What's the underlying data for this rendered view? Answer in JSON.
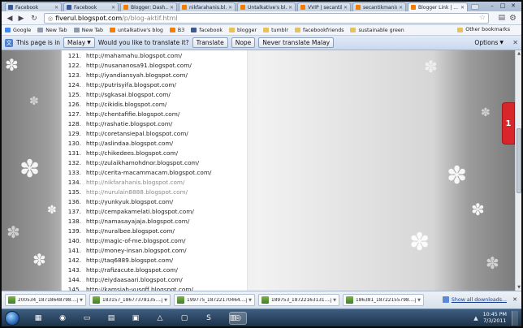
{
  "tabs": [
    {
      "label": "Facebook",
      "color": "#3b5998"
    },
    {
      "label": "Facebook",
      "color": "#3b5998"
    },
    {
      "label": "Blogger: Dash...",
      "color": "#f57d00"
    },
    {
      "label": "nikfarahanis.bl...",
      "color": "#f57d00"
    },
    {
      "label": "Untalkative's bl...",
      "color": "#f57d00"
    },
    {
      "label": "VVIP | secantik...",
      "color": "#f57d00"
    },
    {
      "label": "secantikmanis",
      "color": "#f57d00"
    },
    {
      "label": "Blogger Link | ...",
      "color": "#f57d00"
    }
  ],
  "toolbar": {
    "url_host": "fiverul.blogspot.com",
    "url_path": "/p/blog-aktif.html"
  },
  "bookmarks": [
    {
      "label": "Google",
      "color": "#4285f4"
    },
    {
      "label": "New Tab",
      "color": "#8c9aab"
    },
    {
      "label": "New Tab",
      "color": "#8c9aab"
    },
    {
      "label": "untalkative's blog",
      "color": "#f57d00"
    },
    {
      "label": "B3",
      "color": "#f57d00"
    },
    {
      "label": "facebook",
      "color": "#3b5998"
    },
    {
      "label": "blogger",
      "color": "#e8c15a"
    },
    {
      "label": "tumblr",
      "color": "#e8c15a"
    },
    {
      "label": "facebookfriends",
      "color": "#e8c15a"
    },
    {
      "label": "sustainable green",
      "color": "#e8c15a"
    }
  ],
  "other_bookmarks": "Other bookmarks",
  "translate": {
    "prefix": "This page is in",
    "language": "Malay",
    "question": "Would you like to translate it?",
    "translate_btn": "Translate",
    "nope_btn": "Nope",
    "never_btn": "Never translate Malay",
    "options": "Options"
  },
  "links": [
    {
      "num": "121.",
      "url": "http://mahamahu.blogspot.com/",
      "visited": false
    },
    {
      "num": "122.",
      "url": "http://nusananosa91.blogspot.com/",
      "visited": false
    },
    {
      "num": "123.",
      "url": "http://iyandiansyah.blogspot.com/",
      "visited": false
    },
    {
      "num": "124.",
      "url": "http://putrisyifa.blogspot.com/",
      "visited": false
    },
    {
      "num": "125.",
      "url": "http://sgkasai.blogspot.com/",
      "visited": false
    },
    {
      "num": "126.",
      "url": "http://cikidis.blogspot.com/",
      "visited": false
    },
    {
      "num": "127.",
      "url": "http://chentafifie.blogspot.com/",
      "visited": false
    },
    {
      "num": "128.",
      "url": "http://rashatie.blogspot.com/",
      "visited": false
    },
    {
      "num": "129.",
      "url": "http://coretansiepal.blogspot.com/",
      "visited": false
    },
    {
      "num": "130.",
      "url": "http://aslindaa.blogspot.com/",
      "visited": false
    },
    {
      "num": "131.",
      "url": "http://chikedees.blogspot.com/",
      "visited": false
    },
    {
      "num": "132.",
      "url": "http://zulaikhamohdnor.blogspot.com/",
      "visited": false
    },
    {
      "num": "133.",
      "url": "http://cerita-macammacam.blogspot.com/",
      "visited": false
    },
    {
      "num": "134.",
      "url": "http://nikfarahanis.blogspot.com/",
      "visited": true
    },
    {
      "num": "135.",
      "url": "http://nurulain8888.blogspot.com/",
      "visited": true
    },
    {
      "num": "136.",
      "url": "http://yunkyuk.blogspot.com/",
      "visited": false
    },
    {
      "num": "137.",
      "url": "http://cempakamelati.blogspot.com/",
      "visited": false
    },
    {
      "num": "138.",
      "url": "http://namasayajaja.blogspot.com/",
      "visited": false
    },
    {
      "num": "139.",
      "url": "http://nuralbee.blogspot.com/",
      "visited": false
    },
    {
      "num": "140.",
      "url": "http://magic-of-me.blogspot.com/",
      "visited": false
    },
    {
      "num": "141.",
      "url": "http://money-insan.blogspot.com/",
      "visited": false
    },
    {
      "num": "142.",
      "url": "http://taq6889.blogspot.com/",
      "visited": false
    },
    {
      "num": "143.",
      "url": "http://rafizacute.blogspot.com/",
      "visited": false
    },
    {
      "num": "144.",
      "url": "http://eiydaasaari.blogspot.com/",
      "visited": false
    },
    {
      "num": "145.",
      "url": "http://kamsiah-yusoff.blogspot.com/",
      "visited": false
    }
  ],
  "downloads": [
    {
      "name": "200534_18718648798....jpg"
    },
    {
      "name": "183157_18677378135....jpg"
    },
    {
      "name": "199775_18722170464....jpg"
    },
    {
      "name": "189753_18722163131....jpg"
    },
    {
      "name": "186381_18722155798....jpg"
    }
  ],
  "show_all_downloads": "Show all downloads...",
  "taskbar": {
    "time": "10:45 PM",
    "date": "7/3/2011"
  }
}
